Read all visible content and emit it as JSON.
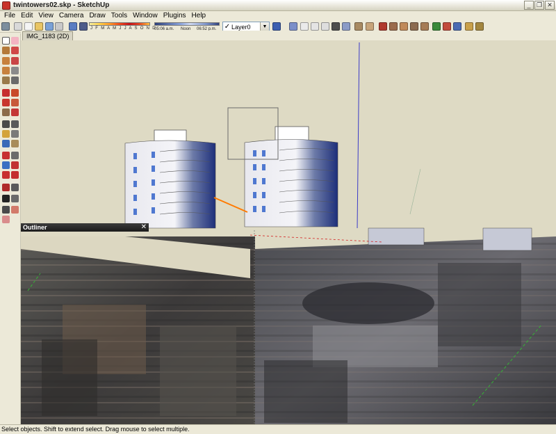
{
  "window": {
    "title": "twintowers02.skp - SketchUp",
    "controls": [
      "_",
      "❐",
      "✕"
    ]
  },
  "menu": [
    "File",
    "Edit",
    "View",
    "Camera",
    "Draw",
    "Tools",
    "Window",
    "Plugins",
    "Help"
  ],
  "shadow_settings": {
    "months": "J F M A M J J A S O N D",
    "sunrise": "05:06 a.m.",
    "noon": "Noon",
    "sunset": "06:52 p.m."
  },
  "layer": {
    "check": "✓",
    "current": "Layer0"
  },
  "scene_tab": "IMG_1183 (2D)",
  "outliner": {
    "title": "Outliner",
    "close": "✕"
  },
  "status_text": "Select objects. Shift to extend select. Drag mouse to select multiple.",
  "colors": {
    "sky": "#dedac4",
    "selection_line": "#ff7a00",
    "axis_blue": "#2a2ae0",
    "axis_green": "#35b535",
    "axis_red": "#d32020"
  },
  "icons": {
    "toolbar": [
      "camera-icon",
      "print-icon",
      "new-icon",
      "open-icon",
      "save-icon",
      "cut-icon",
      "copy-icon",
      "paste-icon",
      "erase-icon",
      "undo-icon",
      "redo-icon",
      "iso-view-icon",
      "top-view-icon",
      "front-view-icon",
      "right-view-icon",
      "back-view-icon",
      "left-view-icon",
      "xray-icon",
      "wireframe-icon",
      "hidden-line-icon",
      "shaded-icon",
      "textured-icon",
      "monochrome-icon",
      "paint-icon",
      "components-icon",
      "materials-icon"
    ],
    "left_tools": [
      "select-icon",
      "eraser-icon",
      "paint-bucket-icon",
      "line-icon",
      "rectangle-icon",
      "circle-icon",
      "arc-icon",
      "polygon-icon",
      "move-icon",
      "push-pull-icon",
      "rotate-icon",
      "follow-me-icon",
      "scale-icon",
      "offset-icon",
      "tape-measure-icon",
      "dimension-icon",
      "protractor-icon",
      "text-icon",
      "axes-icon",
      "3d-text-icon",
      "orbit-icon",
      "pan-icon",
      "zoom-icon",
      "zoom-window-icon",
      "zoom-extents-icon",
      "previous-view-icon",
      "walk-icon",
      "look-around-icon",
      "position-camera-icon",
      "section-icon"
    ]
  }
}
